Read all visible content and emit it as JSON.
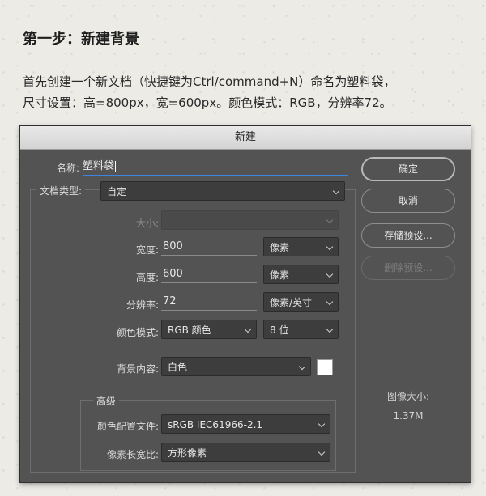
{
  "article": {
    "heading": "第一步：新建背景",
    "desc_line1": "首先创建一个新文档（快捷键为Ctrl/command+N）命名为塑料袋，",
    "desc_line2": "尺寸设置：高=800px，宽=600px。颜色模式：RGB，分辨率72。"
  },
  "dialog": {
    "title": "新建",
    "name_label": "名称:",
    "name_value": "塑料袋",
    "doc_type_label": "文档类型:",
    "doc_type_value": "自定",
    "size_label": "大小:",
    "size_value": "",
    "width_label": "宽度:",
    "width_value": "800",
    "width_unit": "像素",
    "height_label": "高度:",
    "height_value": "600",
    "height_unit": "像素",
    "resolution_label": "分辨率:",
    "resolution_value": "72",
    "resolution_unit": "像素/英寸",
    "color_mode_label": "颜色模式:",
    "color_mode_value": "RGB 颜色",
    "bit_depth_value": "8 位",
    "bg_content_label": "背景内容:",
    "bg_content_value": "白色",
    "bg_swatch_color": "#ffffff",
    "advanced_label": "高级",
    "color_profile_label": "颜色配置文件:",
    "color_profile_value": "sRGB IEC61966-2.1",
    "pixel_aspect_label": "像素长宽比:",
    "pixel_aspect_value": "方形像素",
    "buttons": {
      "ok": "确定",
      "cancel": "取消",
      "save_preset": "存储预设...",
      "delete_preset": "删除预设..."
    },
    "image_size_title": "图像大小:",
    "image_size_value": "1.37M"
  },
  "colors": {
    "dialog_bg": "#535353",
    "focus_accent": "#3b86e0"
  }
}
